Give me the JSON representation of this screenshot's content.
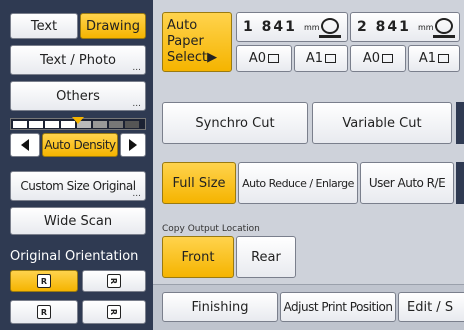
{
  "left_panel": {
    "text_label": "Text",
    "drawing_label": "Drawing",
    "text_photo_label": "Text / Photo",
    "others_label": "Others",
    "auto_density_label": "Auto Density",
    "custom_size_label": "Custom Size Original",
    "wide_scan_label": "Wide Scan",
    "orientation_label": "Original Orientation",
    "ellipsis": "..."
  },
  "paper": {
    "auto_paper_label": "Auto Paper Select▶",
    "tray1_count": "1 841",
    "tray1_unit": "mm",
    "tray2_count": "2 841",
    "tray2_unit": "mm",
    "tray1_size_a": "A0",
    "tray1_size_b": "A1",
    "tray2_size_a": "A0",
    "tray2_size_b": "A1"
  },
  "cut": {
    "synchro_label": "Synchro Cut",
    "variable_label": "Variable Cut"
  },
  "reduce": {
    "full_size_label": "Full Size",
    "auto_reduce_label": "Auto Reduce / Enlarge",
    "user_auto_label": "User Auto R/E"
  },
  "output": {
    "location_label": "Copy Output Location",
    "front_label": "Front",
    "rear_label": "Rear"
  },
  "bottom": {
    "finishing_label": "Finishing",
    "adjust_label": "Adjust Print Position",
    "edit_label": "Edit / S"
  },
  "orientation_icons": {
    "a": "R",
    "b": "R",
    "c": "R",
    "d": "R"
  },
  "colors": {
    "accent_yellow": "#f5b400",
    "panel_dark": "#2f3a52"
  }
}
